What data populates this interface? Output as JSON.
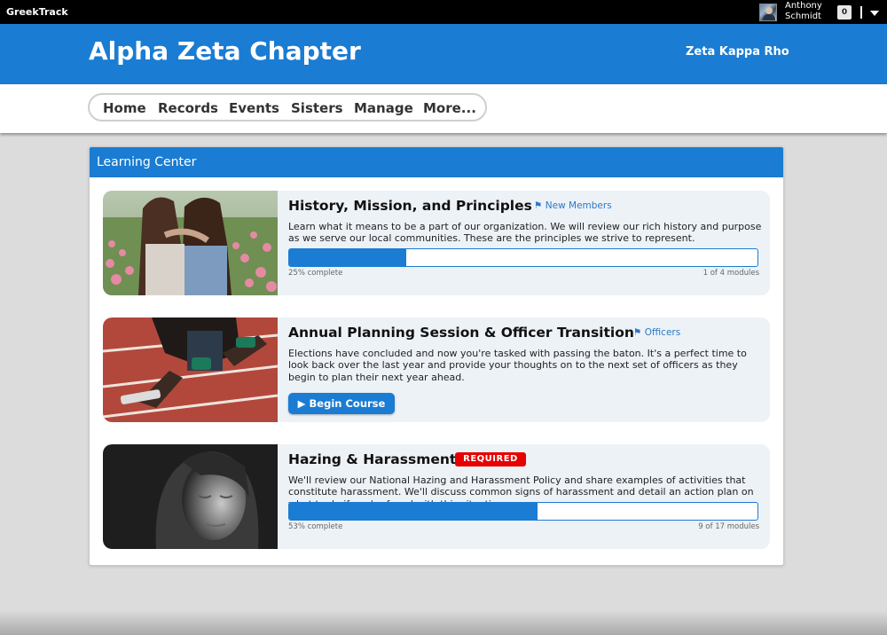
{
  "app": {
    "brand": "GreekTrack"
  },
  "user": {
    "name_line1": "Anthony",
    "name_line2": "Schmidt",
    "notification_count": "0"
  },
  "header": {
    "chapter_title": "Alpha Zeta Chapter",
    "org_name": "Zeta Kappa Rho"
  },
  "nav": {
    "items": [
      {
        "label": "Home"
      },
      {
        "label": "Records"
      },
      {
        "label": "Events"
      },
      {
        "label": "Sisters"
      },
      {
        "label": "Manage"
      },
      {
        "label": "More..."
      }
    ]
  },
  "panel": {
    "title": "Learning Center"
  },
  "courses": [
    {
      "title": "History, Mission, and Principles",
      "audience": "New Members",
      "description": "Learn what it means to be a part of our organization. We will review our rich history and purpose as we serve our local communities. These are the principles we strive to represent.",
      "progress_fraction": 0.25,
      "progress_label": "25% complete",
      "modules_label": "1 of 4 modules"
    },
    {
      "title": "Annual Planning Session & Officer Transition",
      "audience": "Officers",
      "description": "Elections have concluded and now you're tasked with passing the baton. It's a perfect time to look back over the last year and provide your thoughts on to the next set of officers as they begin to plan their next year ahead.",
      "button_label": "Begin Course"
    },
    {
      "title": "Hazing & Harassment",
      "badge": "REQUIRED",
      "description": "We'll review our National Hazing and Harassment Policy and share examples of activities that constitute harassment. We'll discuss common signs of harassment and detail an action plan on what to do if you're faced with this situation.",
      "progress_fraction": 0.53,
      "progress_label": "53% complete",
      "modules_label": "9 of 17 modules"
    }
  ],
  "icons": {
    "tag": "tag-icon",
    "play": "play-icon",
    "caret": "caret-down-icon"
  },
  "colors": {
    "primary": "#1a7cd2",
    "required": "#e60000"
  }
}
